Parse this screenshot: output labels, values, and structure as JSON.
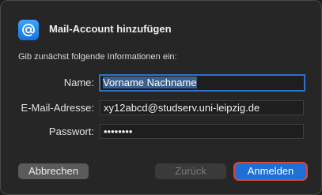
{
  "dialog": {
    "title": "Mail-Account hinzufügen",
    "subtitle": "Gib zunächst folgende Informationen ein:",
    "icon": "mail-at-icon"
  },
  "form": {
    "name_label": "Name:",
    "name_value": "Vorname Nachname",
    "email_label": "E-Mail-Adresse:",
    "email_value": "xy12abcd@studserv.uni-leipzig.de",
    "password_label": "Passwort:",
    "password_value": "••••••••"
  },
  "buttons": {
    "cancel_label": "Abbrechen",
    "back_label": "Zurück",
    "signin_label": "Anmelden"
  },
  "colors": {
    "accent": "#1f6fd8",
    "focus_ring": "#2d73c7",
    "highlight_outline": "#d8453a"
  }
}
